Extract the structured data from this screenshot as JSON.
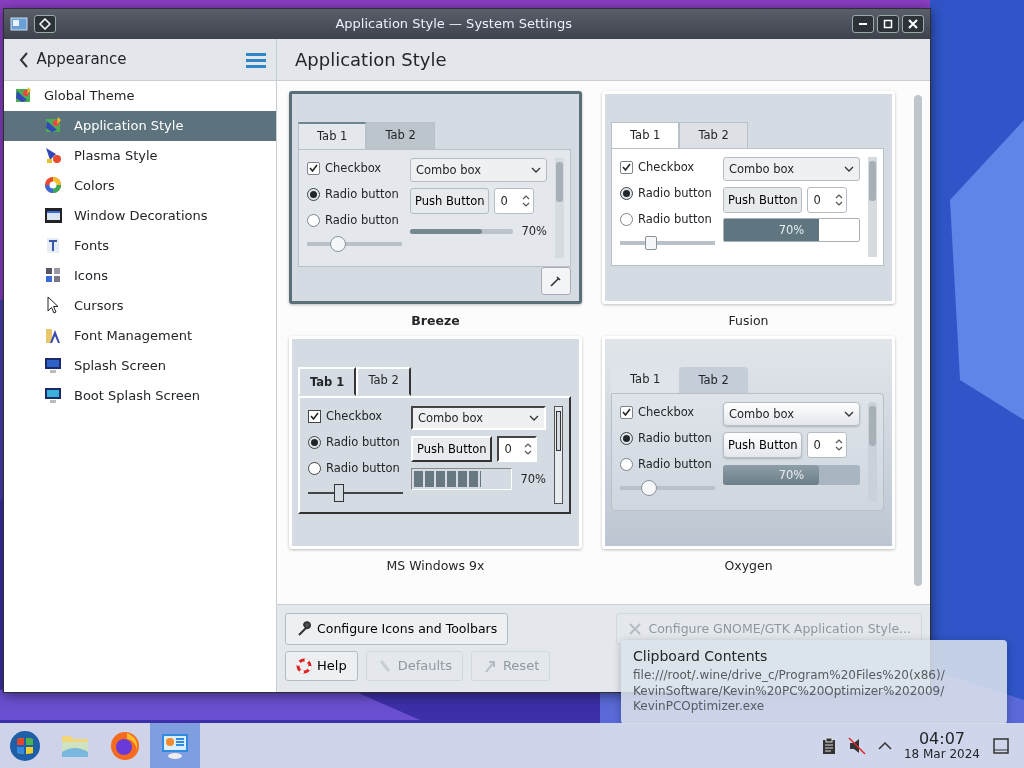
{
  "window": {
    "title": "Application Style — System Settings"
  },
  "sidebar": {
    "back_label": "Appearance",
    "items": [
      {
        "label": "Global Theme",
        "selected": false,
        "children": [
          {
            "label": "Application Style",
            "selected": true
          },
          {
            "label": "Plasma Style",
            "selected": false
          },
          {
            "label": "Colors",
            "selected": false
          },
          {
            "label": "Window Decorations",
            "selected": false
          },
          {
            "label": "Fonts",
            "selected": false
          },
          {
            "label": "Icons",
            "selected": false
          },
          {
            "label": "Cursors",
            "selected": false
          },
          {
            "label": "Font Management",
            "selected": false
          },
          {
            "label": "Splash Screen",
            "selected": false
          },
          {
            "label": "Boot Splash Screen",
            "selected": false
          }
        ]
      }
    ]
  },
  "page": {
    "title": "Application Style"
  },
  "styles": [
    {
      "name": "Breeze",
      "kind": "breeze",
      "selected": true,
      "tabs": [
        {
          "label": "Tab 1",
          "selected": true
        },
        {
          "label": "Tab 2",
          "selected": false
        }
      ],
      "checkbox": {
        "label": "Checkbox",
        "checked": true
      },
      "radios": [
        {
          "label": "Radio button",
          "selected": true
        },
        {
          "label": "Radio button",
          "selected": false
        }
      ],
      "combo": "Combo box",
      "button": "Push Button",
      "spin": "0",
      "slider": {
        "level": 0.33
      },
      "progress": {
        "level": 0.7,
        "reading": "70%"
      }
    },
    {
      "name": "Fusion",
      "kind": "fusion",
      "selected": false,
      "tabs": [
        {
          "label": "Tab 1",
          "selected": true
        },
        {
          "label": "Tab 2",
          "selected": false
        }
      ],
      "checkbox": {
        "label": "Checkbox",
        "checked": true
      },
      "radios": [
        {
          "label": "Radio button",
          "selected": true
        },
        {
          "label": "Radio button",
          "selected": false
        }
      ],
      "combo": "Combo box",
      "button": "Push Button",
      "spin": "0",
      "slider": {
        "level": 0.33
      },
      "progress": {
        "level": 0.7,
        "reading": "70%"
      }
    },
    {
      "name": "MS Windows 9x",
      "kind": "windows9x",
      "selected": false,
      "tabs": [
        {
          "label": "Tab 1",
          "selected": true
        },
        {
          "label": "Tab 2",
          "selected": false
        }
      ],
      "checkbox": {
        "label": "Checkbox",
        "checked": true
      },
      "radios": [
        {
          "label": "Radio button",
          "selected": true
        },
        {
          "label": "Radio button",
          "selected": false
        }
      ],
      "combo": "Combo box",
      "button": "Push Button",
      "spin": "0",
      "slider": {
        "level": 0.33
      },
      "progress": {
        "level": 0.7,
        "reading": "70%"
      }
    },
    {
      "name": "Oxygen",
      "kind": "oxygen",
      "selected": false,
      "tabs": [
        {
          "label": "Tab 1",
          "selected": true
        },
        {
          "label": "Tab 2",
          "selected": false
        }
      ],
      "checkbox": {
        "label": "Checkbox",
        "checked": true
      },
      "radios": [
        {
          "label": "Radio button",
          "selected": true
        },
        {
          "label": "Radio button",
          "selected": false
        }
      ],
      "combo": "Combo box",
      "button": "Push Button",
      "spin": "0",
      "slider": {
        "level": 0.3
      },
      "progress": {
        "level": 0.7,
        "reading": "70%"
      }
    }
  ],
  "actions": [
    {
      "label": "Configure Icons and Toolbars",
      "disabled": false
    },
    {
      "label": "Configure GNOME/GTK Application Style...",
      "disabled": true
    }
  ],
  "footer_buttons": [
    {
      "label": "Help",
      "kind": "help",
      "disabled": false
    },
    {
      "label": "Defaults",
      "kind": "defaults",
      "disabled": true
    },
    {
      "label": "Reset",
      "kind": "reset",
      "disabled": true
    }
  ],
  "notification": {
    "title": "Clipboard Contents",
    "body": "file:///root/.wine/drive_c/Program%20Files%20(x86)/KevinSoftware/Kevin%20PC%20Optimizer%202009/KevinPCOptimizer.exe"
  },
  "taskbar": {
    "apps": [
      {
        "kind": "start",
        "selected": false
      },
      {
        "kind": "files",
        "selected": false
      },
      {
        "kind": "browser",
        "selected": false
      },
      {
        "kind": "settings",
        "selected": true
      }
    ],
    "clock": {
      "time": "04:07",
      "date": "18 Mar 2024"
    }
  }
}
